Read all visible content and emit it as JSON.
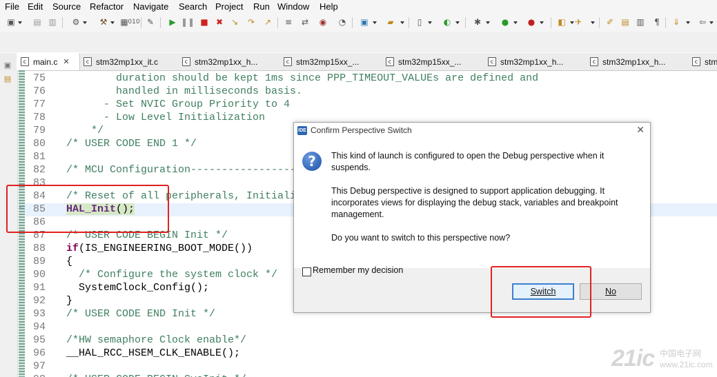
{
  "menu": [
    "File",
    "Edit",
    "Source",
    "Refactor",
    "Navigate",
    "Search",
    "Project",
    "Run",
    "Window",
    "Help"
  ],
  "tabs": [
    {
      "label": "main.c",
      "active": true
    },
    {
      "label": "stm32mp1xx_it.c"
    },
    {
      "label": "stm32mp1xx_h..."
    },
    {
      "label": "stm32mp15xx_..."
    },
    {
      "label": "stm32mp15xx_..."
    },
    {
      "label": "stm32mp1xx_h..."
    },
    {
      "label": "stm32mp1xx_h..."
    },
    {
      "label": "stm"
    }
  ],
  "code_lines": [
    {
      "num": "75",
      "text": "        duration should be kept 1ms since PPP_TIMEOUT_VALUEs are defined and",
      "style": "cm"
    },
    {
      "num": "76",
      "text": "        handled in milliseconds basis.",
      "style": "cm"
    },
    {
      "num": "77",
      "text": "      - Set NVIC Group Priority to 4",
      "style": "cm"
    },
    {
      "num": "78",
      "text": "      - Low Level Initialization",
      "style": "cm"
    },
    {
      "num": "79",
      "text": "    */",
      "style": "cm"
    },
    {
      "num": "80",
      "text": "/* USER CODE END 1 */",
      "style": "cm"
    },
    {
      "num": "81",
      "text": "",
      "style": ""
    },
    {
      "num": "82",
      "text": "/* MCU Configuration----------------------",
      "style": "cm"
    },
    {
      "num": "83",
      "text": "",
      "style": ""
    },
    {
      "num": "84",
      "text": "/* Reset of all peripherals, Initializ",
      "style": "cm"
    },
    {
      "num": "85",
      "text": "HAL_Init();",
      "style": "hal"
    },
    {
      "num": "86",
      "text": "",
      "style": ""
    },
    {
      "num": "87",
      "text": "/* USER CODE BEGIN Init */",
      "style": "cm"
    },
    {
      "num": "88",
      "text": "if(IS_ENGINEERING_BOOT_MODE())",
      "style": "if"
    },
    {
      "num": "89",
      "text": "{",
      "style": ""
    },
    {
      "num": "90",
      "text": "  /* Configure the system clock */",
      "style": "cm"
    },
    {
      "num": "91",
      "text": "  SystemClock_Config();",
      "style": ""
    },
    {
      "num": "92",
      "text": "}",
      "style": ""
    },
    {
      "num": "93",
      "text": "/* USER CODE END Init */",
      "style": "cm"
    },
    {
      "num": "94",
      "text": "",
      "style": ""
    },
    {
      "num": "95",
      "text": "/*HW semaphore Clock enable*/",
      "style": "cm"
    },
    {
      "num": "96",
      "text": "__HAL_RCC_HSEM_CLK_ENABLE();",
      "style": ""
    },
    {
      "num": "97",
      "text": "",
      "style": ""
    },
    {
      "num": "98",
      "text": "/* USER CODE BEGIN SysInit */",
      "style": "cm"
    }
  ],
  "dialog": {
    "title": "Confirm Perspective Switch",
    "badge": "IDE",
    "para1": "This kind of launch is configured to open the Debug perspective when it suspends.",
    "para2": "This Debug perspective is designed to support application debugging. It incorporates views for displaying the debug stack, variables and breakpoint management.",
    "para3": "Do you want to switch to this perspective now?",
    "remember_label": "Remember my decision",
    "remember_checked": false,
    "switch_label": "Switch",
    "no_label": "No"
  },
  "watermark": {
    "text": "21ic",
    "sub1": "中国电子网",
    "sub2": "www.21ic.com"
  },
  "colors": {
    "comment": "#3f7f5f",
    "keyword": "#7f0055",
    "annotation": "#e02020",
    "hal_highlight": "#d7e8c7"
  }
}
